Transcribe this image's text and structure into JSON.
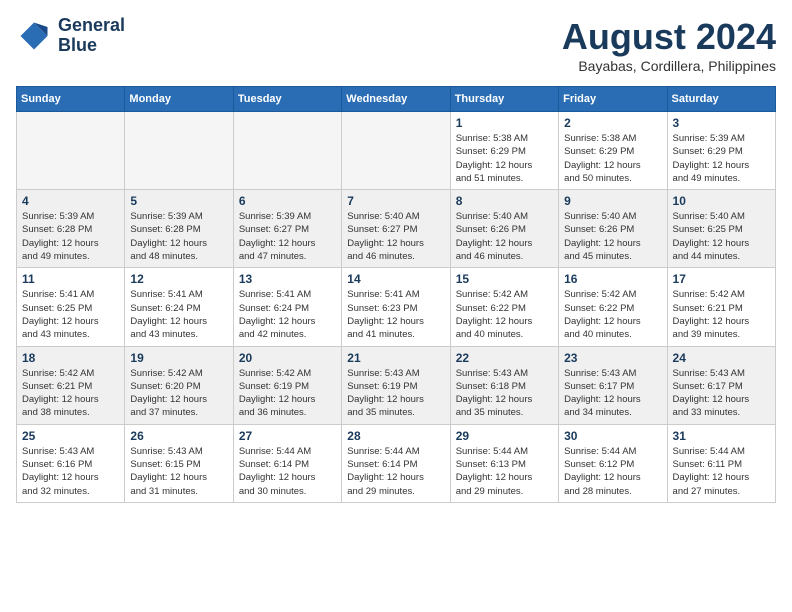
{
  "header": {
    "logo_line1": "General",
    "logo_line2": "Blue",
    "title": "August 2024",
    "subtitle": "Bayabas, Cordillera, Philippines"
  },
  "weekdays": [
    "Sunday",
    "Monday",
    "Tuesday",
    "Wednesday",
    "Thursday",
    "Friday",
    "Saturday"
  ],
  "weeks": [
    [
      {
        "day": "",
        "info": ""
      },
      {
        "day": "",
        "info": ""
      },
      {
        "day": "",
        "info": ""
      },
      {
        "day": "",
        "info": ""
      },
      {
        "day": "1",
        "info": "Sunrise: 5:38 AM\nSunset: 6:29 PM\nDaylight: 12 hours\nand 51 minutes."
      },
      {
        "day": "2",
        "info": "Sunrise: 5:38 AM\nSunset: 6:29 PM\nDaylight: 12 hours\nand 50 minutes."
      },
      {
        "day": "3",
        "info": "Sunrise: 5:39 AM\nSunset: 6:29 PM\nDaylight: 12 hours\nand 49 minutes."
      }
    ],
    [
      {
        "day": "4",
        "info": "Sunrise: 5:39 AM\nSunset: 6:28 PM\nDaylight: 12 hours\nand 49 minutes."
      },
      {
        "day": "5",
        "info": "Sunrise: 5:39 AM\nSunset: 6:28 PM\nDaylight: 12 hours\nand 48 minutes."
      },
      {
        "day": "6",
        "info": "Sunrise: 5:39 AM\nSunset: 6:27 PM\nDaylight: 12 hours\nand 47 minutes."
      },
      {
        "day": "7",
        "info": "Sunrise: 5:40 AM\nSunset: 6:27 PM\nDaylight: 12 hours\nand 46 minutes."
      },
      {
        "day": "8",
        "info": "Sunrise: 5:40 AM\nSunset: 6:26 PM\nDaylight: 12 hours\nand 46 minutes."
      },
      {
        "day": "9",
        "info": "Sunrise: 5:40 AM\nSunset: 6:26 PM\nDaylight: 12 hours\nand 45 minutes."
      },
      {
        "day": "10",
        "info": "Sunrise: 5:40 AM\nSunset: 6:25 PM\nDaylight: 12 hours\nand 44 minutes."
      }
    ],
    [
      {
        "day": "11",
        "info": "Sunrise: 5:41 AM\nSunset: 6:25 PM\nDaylight: 12 hours\nand 43 minutes."
      },
      {
        "day": "12",
        "info": "Sunrise: 5:41 AM\nSunset: 6:24 PM\nDaylight: 12 hours\nand 43 minutes."
      },
      {
        "day": "13",
        "info": "Sunrise: 5:41 AM\nSunset: 6:24 PM\nDaylight: 12 hours\nand 42 minutes."
      },
      {
        "day": "14",
        "info": "Sunrise: 5:41 AM\nSunset: 6:23 PM\nDaylight: 12 hours\nand 41 minutes."
      },
      {
        "day": "15",
        "info": "Sunrise: 5:42 AM\nSunset: 6:22 PM\nDaylight: 12 hours\nand 40 minutes."
      },
      {
        "day": "16",
        "info": "Sunrise: 5:42 AM\nSunset: 6:22 PM\nDaylight: 12 hours\nand 40 minutes."
      },
      {
        "day": "17",
        "info": "Sunrise: 5:42 AM\nSunset: 6:21 PM\nDaylight: 12 hours\nand 39 minutes."
      }
    ],
    [
      {
        "day": "18",
        "info": "Sunrise: 5:42 AM\nSunset: 6:21 PM\nDaylight: 12 hours\nand 38 minutes."
      },
      {
        "day": "19",
        "info": "Sunrise: 5:42 AM\nSunset: 6:20 PM\nDaylight: 12 hours\nand 37 minutes."
      },
      {
        "day": "20",
        "info": "Sunrise: 5:42 AM\nSunset: 6:19 PM\nDaylight: 12 hours\nand 36 minutes."
      },
      {
        "day": "21",
        "info": "Sunrise: 5:43 AM\nSunset: 6:19 PM\nDaylight: 12 hours\nand 35 minutes."
      },
      {
        "day": "22",
        "info": "Sunrise: 5:43 AM\nSunset: 6:18 PM\nDaylight: 12 hours\nand 35 minutes."
      },
      {
        "day": "23",
        "info": "Sunrise: 5:43 AM\nSunset: 6:17 PM\nDaylight: 12 hours\nand 34 minutes."
      },
      {
        "day": "24",
        "info": "Sunrise: 5:43 AM\nSunset: 6:17 PM\nDaylight: 12 hours\nand 33 minutes."
      }
    ],
    [
      {
        "day": "25",
        "info": "Sunrise: 5:43 AM\nSunset: 6:16 PM\nDaylight: 12 hours\nand 32 minutes."
      },
      {
        "day": "26",
        "info": "Sunrise: 5:43 AM\nSunset: 6:15 PM\nDaylight: 12 hours\nand 31 minutes."
      },
      {
        "day": "27",
        "info": "Sunrise: 5:44 AM\nSunset: 6:14 PM\nDaylight: 12 hours\nand 30 minutes."
      },
      {
        "day": "28",
        "info": "Sunrise: 5:44 AM\nSunset: 6:14 PM\nDaylight: 12 hours\nand 29 minutes."
      },
      {
        "day": "29",
        "info": "Sunrise: 5:44 AM\nSunset: 6:13 PM\nDaylight: 12 hours\nand 29 minutes."
      },
      {
        "day": "30",
        "info": "Sunrise: 5:44 AM\nSunset: 6:12 PM\nDaylight: 12 hours\nand 28 minutes."
      },
      {
        "day": "31",
        "info": "Sunrise: 5:44 AM\nSunset: 6:11 PM\nDaylight: 12 hours\nand 27 minutes."
      }
    ]
  ]
}
